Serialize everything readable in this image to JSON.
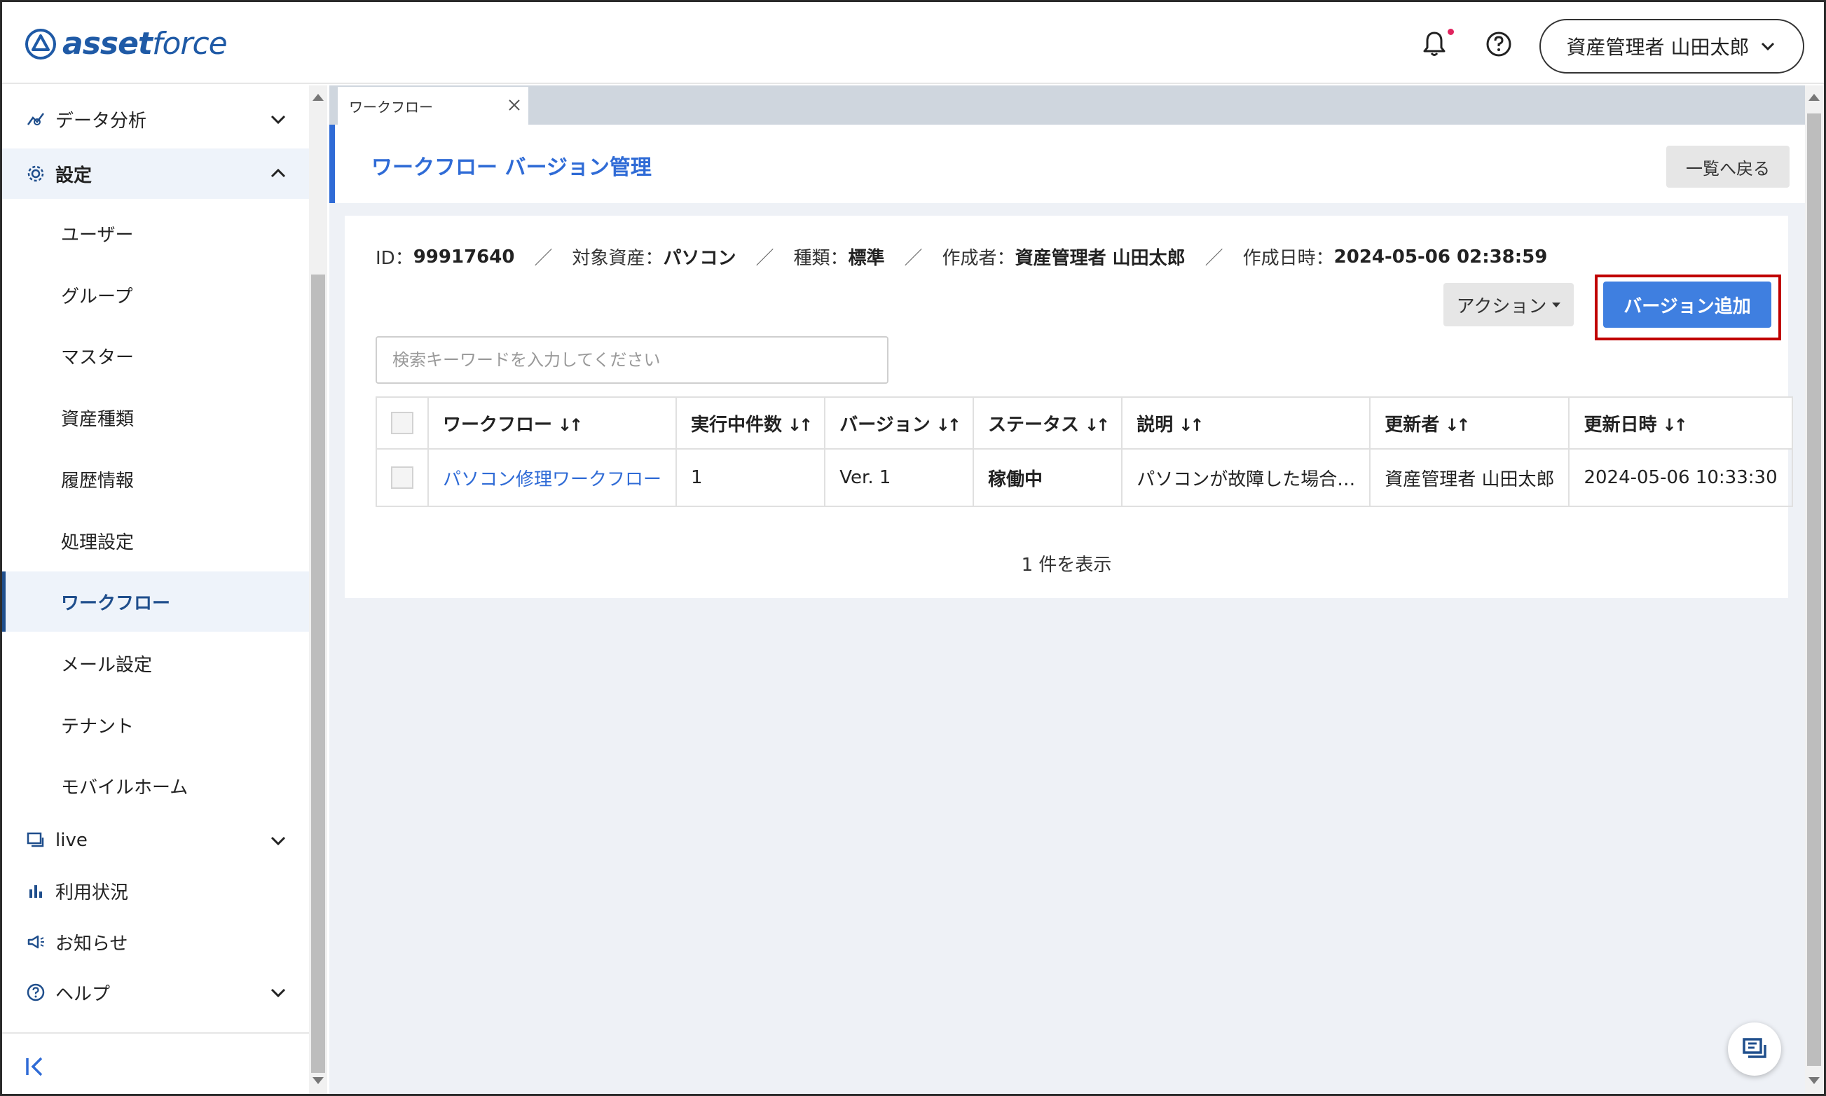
{
  "header": {
    "logo_bold": "asset",
    "logo_rest": "force",
    "user_name": "資産管理者 山田太郎"
  },
  "sidebar": {
    "data_analysis": "データ分析",
    "settings": "設定",
    "sub_items": [
      "ユーザー",
      "グループ",
      "マスター",
      "資産種類",
      "履歴情報",
      "処理設定",
      "ワークフロー",
      "メール設定",
      "テナント",
      "モバイルホーム"
    ],
    "active_sub": "ワークフロー",
    "live": "live",
    "usage": "利用状況",
    "news": "お知らせ",
    "help": "ヘルプ"
  },
  "tabs": [
    {
      "label": "ワークフロー"
    }
  ],
  "page": {
    "title": "ワークフロー バージョン管理",
    "back_label": "一覧へ戻る"
  },
  "meta": {
    "id_key": "ID：",
    "id_val": "99917640",
    "asset_key": "対象資産：",
    "asset_val": "パソコン",
    "type_key": "種類：",
    "type_val": "標準",
    "creator_key": "作成者：",
    "creator_val": "資産管理者 山田太郎",
    "created_key": "作成日時：",
    "created_val": "2024-05-06 02:38:59",
    "sep": "／"
  },
  "toolbar": {
    "action_label": "アクション",
    "add_version_label": "バージョン追加"
  },
  "search": {
    "placeholder": "検索キーワードを入力してください"
  },
  "table": {
    "columns": [
      "ワークフロー",
      "実行中件数",
      "バージョン",
      "ステータス",
      "説明",
      "更新者",
      "更新日時"
    ],
    "sort_glyph": "↓↑",
    "rows": [
      {
        "workflow": "パソコン修理ワークフロー",
        "running": "1",
        "version": "Ver. 1",
        "status": "稼働中",
        "description": "パソコンが故障した場合…",
        "updater": "資産管理者 山田太郎",
        "updated": "2024-05-06 10:33:30"
      }
    ]
  },
  "footer": {
    "count_text": "1 件を表示"
  },
  "colors": {
    "accent": "#2f6bd6",
    "primary_button": "#3f7fe0",
    "highlight": "#c00000",
    "logo": "#1f5aa6"
  }
}
